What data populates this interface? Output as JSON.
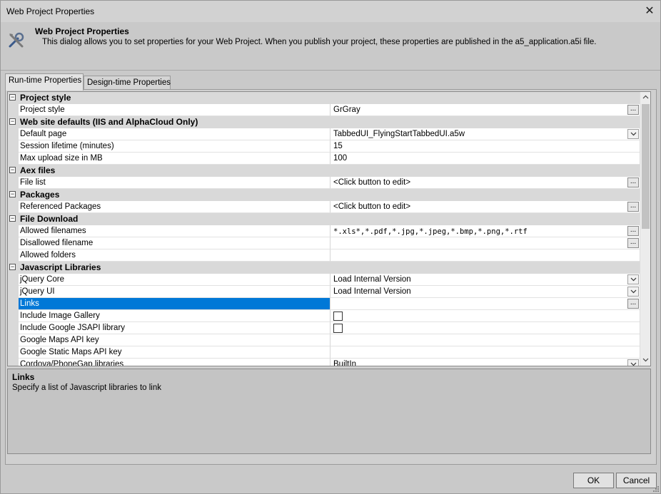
{
  "window": {
    "title": "Web Project Properties",
    "close_glyph": "✕"
  },
  "header": {
    "icon": "tools-icon",
    "title": "Web Project Properties",
    "description": "This dialog allows you to set properties for your Web Project. When you publish your project, these properties are published in the a5_application.a5i file."
  },
  "tabs": [
    {
      "label": "Run-time Properties",
      "active": true
    },
    {
      "label": "Design-time Properties",
      "active": false
    }
  ],
  "grid": {
    "categories": {
      "project_style": "Project style",
      "web_site_defaults": "Web site defaults (IIS and AlphaCloud Only)",
      "aex_files": "Aex files",
      "packages": "Packages",
      "file_download": "File Download",
      "javascript_libraries": "Javascript Libraries"
    },
    "props": {
      "project_style": {
        "name": "Project style",
        "value": "GrGray"
      },
      "default_page": {
        "name": "Default page",
        "value": "TabbedUI_FlyingStartTabbedUI.a5w"
      },
      "session_lifetime": {
        "name": "Session lifetime (minutes)",
        "value": "15"
      },
      "max_upload": {
        "name": "Max upload size in MB",
        "value": "100"
      },
      "file_list": {
        "name": "File list",
        "value": "<Click button to edit>"
      },
      "referenced_packages": {
        "name": "Referenced Packages",
        "value": "<Click button to edit>"
      },
      "allowed_filenames": {
        "name": "Allowed filenames",
        "value": "*.xls*,*.pdf,*.jpg,*.jpeg,*.bmp,*.png,*.rtf"
      },
      "disallowed_filename": {
        "name": "Disallowed filename",
        "value": ""
      },
      "allowed_folders": {
        "name": "Allowed folders",
        "value": ""
      },
      "jquery_core": {
        "name": "jQuery Core",
        "value": "Load Internal Version"
      },
      "jquery_ui": {
        "name": "jQuery UI",
        "value": "Load Internal Version"
      },
      "links": {
        "name": "Links",
        "value": ""
      },
      "include_image_gallery": {
        "name": "Include Image Gallery",
        "value": ""
      },
      "include_google_jsapi": {
        "name": "Include Google JSAPI library",
        "value": ""
      },
      "google_maps_api_key": {
        "name": "Google Maps API key",
        "value": ""
      },
      "google_static_maps_api_key": {
        "name": "Google Static Maps API key",
        "value": ""
      },
      "cordova_libraries": {
        "name": "Cordova/PhoneGap libraries",
        "value": "BuiltIn"
      }
    },
    "expander_glyph": "−",
    "ellipsis_glyph": "...",
    "selected_property": "Links"
  },
  "description_panel": {
    "title": "Links",
    "text": "Specify a list of Javascript libraries to link"
  },
  "buttons": {
    "ok": "OK",
    "cancel": "Cancel"
  }
}
